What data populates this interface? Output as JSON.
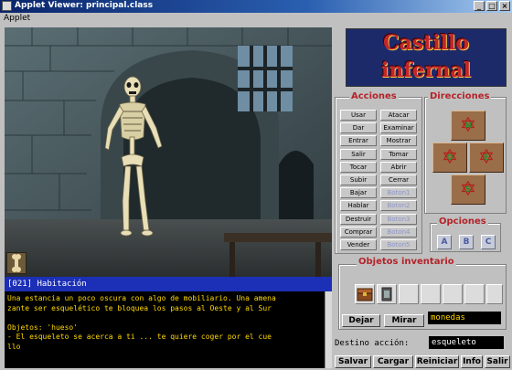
{
  "window": {
    "title": "Applet Viewer: principal.class",
    "menu": "Applet"
  },
  "logo": {
    "line1": "Castillo",
    "line2": "infernal"
  },
  "acciones": {
    "title": "Acciones",
    "buttons": [
      {
        "label": "Usar",
        "enabled": true
      },
      {
        "label": "Atacar",
        "enabled": true
      },
      {
        "label": "Dar",
        "enabled": true
      },
      {
        "label": "Examinar",
        "enabled": true
      },
      {
        "label": "Entrar",
        "enabled": true
      },
      {
        "label": "Mostrar",
        "enabled": true
      },
      {
        "label": "Salir",
        "enabled": true
      },
      {
        "label": "Tomar",
        "enabled": true
      },
      {
        "label": "Tocar",
        "enabled": true
      },
      {
        "label": "Abrir",
        "enabled": true
      },
      {
        "label": "Subir",
        "enabled": true
      },
      {
        "label": "Cerrar",
        "enabled": true
      },
      {
        "label": "Bajar",
        "enabled": true
      },
      {
        "label": "Boton1",
        "enabled": false
      },
      {
        "label": "Hablar",
        "enabled": true
      },
      {
        "label": "Boton2",
        "enabled": false
      },
      {
        "label": "Destruir",
        "enabled": true
      },
      {
        "label": "Boton3",
        "enabled": false
      },
      {
        "label": "Comprar",
        "enabled": true
      },
      {
        "label": "Boton4",
        "enabled": false
      },
      {
        "label": "Vender",
        "enabled": true
      },
      {
        "label": "Boton5",
        "enabled": false
      }
    ]
  },
  "direcciones": {
    "title": "Direcciones",
    "n": "N",
    "o": "O",
    "e": "E",
    "s": "S"
  },
  "opciones": {
    "title": "Opciones",
    "a": "A",
    "b": "B",
    "c": "C"
  },
  "inventario": {
    "title": "Objetos inventario",
    "dejar": "Dejar",
    "mirar": "Mirar",
    "monedas": "monedas"
  },
  "destino": {
    "label": "Destino acción:",
    "value": "esqueleto"
  },
  "bottom_buttons": {
    "salvar": "Salvar",
    "cargar": "Cargar",
    "reiniciar": "Reiniciar",
    "info": "Info",
    "salir": "Salir"
  },
  "room": {
    "title": "[021] Habitación"
  },
  "text_lines": [
    "Una estancia un poco oscura con algo de mobiliario. Una amena",
    "zante ser esquelético te bloquea los pasos al Oeste y al Sur",
    "",
    "Objetos: 'hueso'",
    "- El esqueleto se acerca a ti ... te quiere coger por el cue",
    "llo"
  ],
  "colors": {
    "title_bar": "#0a246a",
    "room_bar": "#1c2fb7",
    "text": "#ffd800",
    "heading": "#b3242a"
  }
}
